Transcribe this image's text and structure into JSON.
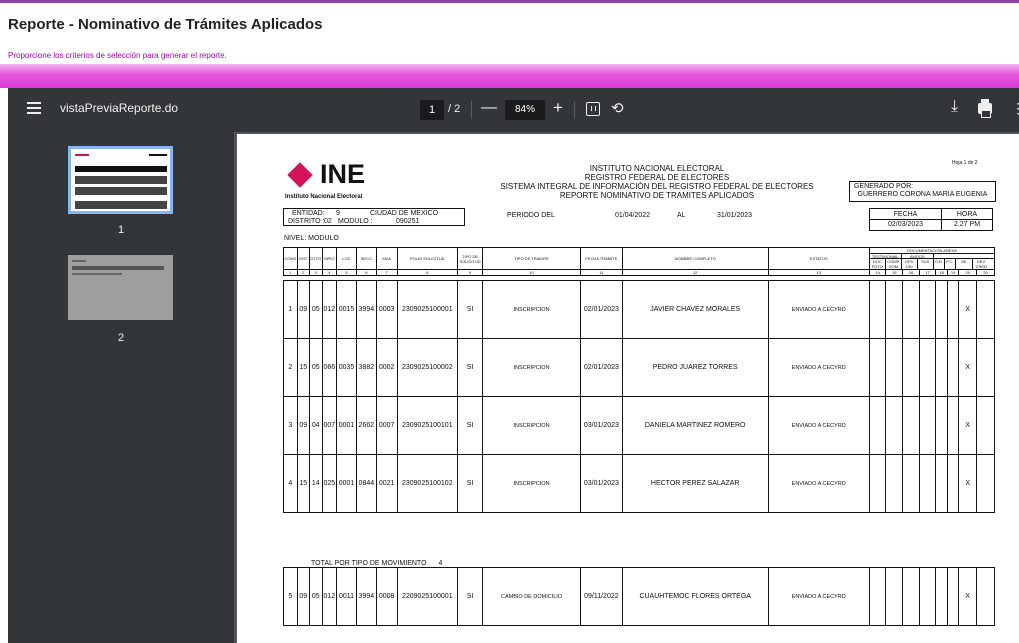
{
  "page": {
    "title": "Reporte - Nominativo de Trámites Aplicados",
    "subtitle": "Proporcione los criterios de selección para generar el reporte."
  },
  "viewer": {
    "filename": "vistaPreviaReporte.do",
    "page_current": "1",
    "page_total": "/ 2",
    "zoom": "84%",
    "thumbs": [
      {
        "label": "1"
      },
      {
        "label": "2"
      }
    ],
    "icons": {
      "menu": "hamburger-menu-icon",
      "zoom_out": "minus-icon",
      "zoom_in": "plus-icon",
      "fit": "fit-page-icon",
      "rotate": "rotate-icon",
      "download": "download-icon",
      "print": "print-icon",
      "more": "more-vert-icon"
    },
    "glyphs": {
      "minus": "—",
      "plus": "+",
      "rotate": "⟲",
      "download": "⤓",
      "more": "⋮"
    }
  },
  "report": {
    "logo_text": "INE",
    "logo_sub": "Instituto Nacional Electoral",
    "header_lines": [
      "INSTITUTO NACIONAL ELECTORAL",
      "REGISTRO FEDERAL DE ELECTORES",
      "SISTEMA INTEGRAL DE INFORMACIÓN DEL REGISTRO FEDERAL DE ELECTORES",
      "REPORTE NOMINATIVO DE TRAMITES APLICADOS"
    ],
    "hoja": "Hoja 1 de 2",
    "generado_label": "GENERADO POR:",
    "generado_value": "GUERRERO CORONA MARIA EUGENIA",
    "entidad_label": "ENTIDAD:",
    "entidad_value": "9",
    "ciudad": "CIUDAD DE MEXICO",
    "distrito_label": "DISTRITO :",
    "distrito_value": "02",
    "modulo_label": "MODULO :",
    "modulo_value": "090251",
    "periodo_label": "PERIODO DEL",
    "periodo_desde": "01/04/2022",
    "periodo_al": "AL",
    "periodo_hasta": "31/01/2023",
    "fecha_label": "FECHA",
    "hora_label": "HORA",
    "fecha_value": "02/03/2023",
    "hora_value": "2.27 PM",
    "nivel": "NIVEL: MÓDULO",
    "doc_anexa": "DOCUMENTACIÓN ANEXA",
    "testimonial": "TESTIMONIAL",
    "avisos": "AVISOS",
    "columns": [
      "CONS",
      "ENT",
      "DTTO",
      "MPIO",
      "LOC",
      "SECC",
      "MZA",
      "FOLIO SOLICITUD",
      "TIPO DE SOLICITUD",
      "TIPO DE TRAMITE",
      "FECHA TRÁMITE",
      "NOMBRE COMPLETO",
      "ESTATUS",
      "DOC FOTO",
      "COMP DOM",
      "DPV USI",
      "SUS",
      "O.R.",
      "F.C.",
      "SE",
      "DEV. CRED"
    ],
    "column_numbers": [
      "1",
      "2",
      "3",
      "4",
      "5",
      "6",
      "7",
      "8",
      "9",
      "10",
      "11",
      "12",
      "13",
      "14",
      "15",
      "16",
      "17",
      "18",
      "19",
      "20",
      "20"
    ],
    "rows": [
      [
        "1",
        "09",
        "05",
        "012",
        "0015",
        "3994",
        "0003",
        "2309025100001",
        "SI",
        "INSCRIPCION",
        "02/01/2023",
        "JAVIER CHAVEZ MORALES",
        "ENVIADO A CECYRD",
        "",
        "",
        "",
        "",
        "",
        "",
        "X",
        ""
      ],
      [
        "2",
        "15",
        "05",
        "066",
        "0035",
        "3882",
        "0002",
        "2309025100002",
        "SI",
        "INSCRIPCION",
        "02/01/2023",
        "PEDRO JUAREZ TORRES",
        "ENVIADO A CECYRD",
        "",
        "",
        "",
        "",
        "",
        "",
        "X",
        ""
      ],
      [
        "3",
        "09",
        "04",
        "007",
        "0001",
        "2662",
        "0007",
        "2309025100101",
        "SI",
        "INSCRIPCION",
        "03/01/2023",
        "DANIELA MARTINEZ ROMERO",
        "ENVIADO A CECYRD",
        "",
        "",
        "",
        "",
        "",
        "",
        "X",
        ""
      ],
      [
        "4",
        "15",
        "14",
        "025",
        "0001",
        "0844",
        "0021",
        "2309025100102",
        "SI",
        "INSCRIPCION",
        "03/01/2023",
        "HECTOR PEREZ SALAZAR",
        "ENVIADO A CECYRD",
        "",
        "",
        "",
        "",
        "",
        "",
        "X",
        ""
      ]
    ],
    "total_label": "TOTAL POR TIPO DE MOVIMIENTO",
    "total_value": "4",
    "rows2": [
      [
        "5",
        "09",
        "05",
        "012",
        "0011",
        "3994",
        "0008",
        "2209025100001",
        "SI",
        "CAMBIO DE DOMICILIO",
        "09/11/2022",
        "CUAUHTEMOC FLORES ORTEGA",
        "ENVIADO A CECYRD",
        "",
        "",
        "",
        "",
        "",
        "",
        "X",
        ""
      ]
    ]
  }
}
